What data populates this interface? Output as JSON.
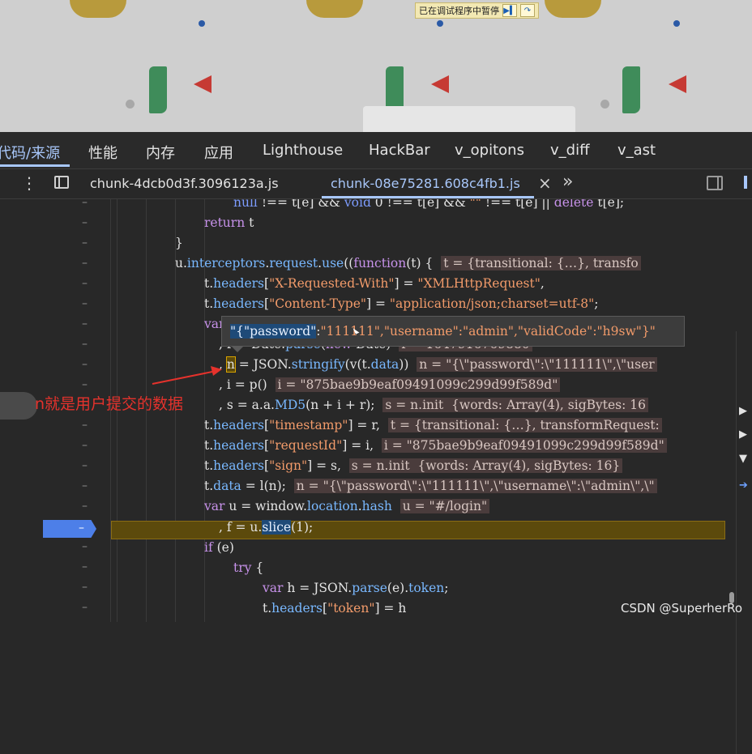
{
  "paused_banner": {
    "text": "已在调试程序中暂停",
    "resume_icon": "resume-icon",
    "step_over_icon": "step-over-icon"
  },
  "main_tabs": [
    "代码/来源",
    "性能",
    "内存",
    "应用",
    "Lighthouse",
    "HackBar",
    "v_opitons",
    "v_diff",
    "v_ast"
  ],
  "file_tabs": {
    "tab1": "chunk-4dcb0d3f.3096123a.js",
    "tab2": "chunk-08e75281.608c4fb1.js"
  },
  "code_lines": [
    "null !== t[e] && void 0 !== t[e] && \"\" !== t[e] || delete t[e];",
    "return t",
    "}",
    "u.interceptors.request.use((function(t) {",
    "t.headers[\"X-Requested-With\"] = \"XMLHttpRequest\",",
    "t.headers[\"Content-Type\"] = \"application/json;charset=utf-8\";",
    "var",
    ", r = Date.parse(new Date)",
    ", n = JSON.stringify(v(t.data))",
    ", i = p()",
    ", s = a.a.MD5(n + i + r);",
    "t.headers[\"timestamp\"] = r,",
    "t.headers[\"requestId\"] = i,",
    "t.headers[\"sign\"] = s,",
    "t.data = l(n);",
    "var u = window.location.hash",
    ", f = u.slice(1);",
    "if (e)",
    "try {",
    "var h = JSON.parse(e).token;",
    "t.headers[\"token\"] = h"
  ],
  "inline_values": {
    "t_arg": "t = {transitional: {…}, transfo",
    "r_val": "r = 1647916769880",
    "n_val": "n = \"{\\\"password\\\":\\\"111111\\\",\\\"user",
    "i_val": "i = \"875bae9b9eaf09491099c299d99f589d\"",
    "s_val": "s = n.init  {words: Array(4), sigBytes: 16",
    "t_val": "t = {transitional: {…}, transformRequest:",
    "i_val2": "i = \"875bae9b9eaf09491099c299d99f589d\"",
    "s_val2": "s = n.init  {words: Array(4), sigBytes: 16}",
    "n_val2": "n = \"{\\\"password\\\":\\\"111111\\\",\\\"username\\\":\\\"admin\\\",\\\"",
    "u_val": "u = \"#/login\""
  },
  "tooltip": "\"{\"password\":\"111111\",\"username\":\"admin\",\"validCode\":\"h9sw\"}\"",
  "annotation": "n就是用户提交的数据",
  "watermark": "CSDN @SuperherRo",
  "colors": {
    "accent": "#a8c7fa",
    "breakpoint": "#4d7fe8",
    "exec_line": "#5c4a0c",
    "annotation": "#e5322c"
  }
}
